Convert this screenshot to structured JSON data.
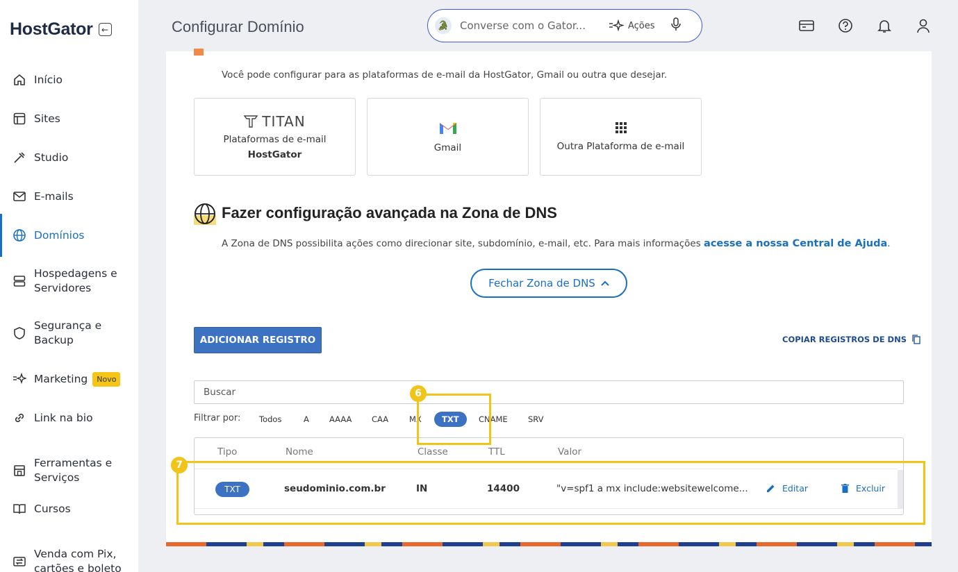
{
  "sidebar": {
    "logo": "HostGator",
    "items": [
      {
        "label": "Início",
        "icon": "home-icon"
      },
      {
        "label": "Sites",
        "icon": "layout-icon"
      },
      {
        "label": "Studio",
        "icon": "wand-icon"
      },
      {
        "label": "E-mails",
        "icon": "mail-icon"
      },
      {
        "label": "Domínios",
        "icon": "globe-icon",
        "active": true
      },
      {
        "label1": "Hospedagens e",
        "label2": "Servidores",
        "icon": "server-icon"
      },
      {
        "label1": "Segurança e",
        "label2": "Backup",
        "icon": "shield-icon"
      },
      {
        "label": "Marketing",
        "badge": "Novo",
        "icon": "sparkle-icon"
      },
      {
        "label": "Link na bio",
        "icon": "link-icon"
      },
      {
        "label1": "Ferramentas e",
        "label2": "Serviços",
        "icon": "store-icon"
      },
      {
        "label": "Cursos",
        "icon": "book-icon"
      },
      {
        "label1": "Venda com Pix,",
        "label2": "cartões e boleto",
        "icon": "exchange-icon"
      }
    ]
  },
  "header": {
    "title": "Configurar Domínio",
    "search_placeholder": "Converse com o Gator...",
    "actions_label": "Ações"
  },
  "email_section": {
    "description": "Você pode configurar para as plataformas de e-mail da HostGator, Gmail ou outra que desejar.",
    "options": [
      {
        "logo_text": "TITAN",
        "label": "Plataformas de e-mail",
        "sublabel": "HostGator"
      },
      {
        "label": "Gmail"
      },
      {
        "label": "Outra Plataforma de e-mail"
      }
    ]
  },
  "dns_section": {
    "title": "Fazer configuração avançada na Zona de DNS",
    "description": "A Zona de DNS possibilita ações como direcionar site, subdomínio, e-mail, etc. Para mais informações",
    "link": "acesse a nossa Central de Ajuda",
    "close_button": "Fechar Zona de DNS",
    "add_button": "ADICIONAR REGISTRO",
    "copy_button": "COPIAR REGISTROS DE DNS",
    "search_placeholder": "Buscar",
    "filter_label": "Filtrar por:",
    "filters": [
      "Todos",
      "A",
      "AAAA",
      "CAA",
      "MX",
      "TXT",
      "CNAME",
      "SRV"
    ],
    "active_filter": "TXT",
    "table": {
      "headers": [
        "Tipo",
        "Nome",
        "Classe",
        "TTL",
        "Valor"
      ],
      "rows": [
        {
          "tipo": "TXT",
          "nome": "seudominio.com.br",
          "classe": "IN",
          "ttl": "14400",
          "valor": "\"v=spf1 a mx include:websitewelcome...",
          "edit": "Editar",
          "delete": "Excluir"
        }
      ]
    }
  },
  "annotations": {
    "six": "6",
    "seven": "7"
  },
  "colors": {
    "accent": "#1a6fc1",
    "button": "#3c72c1",
    "highlight": "#f0c419"
  }
}
